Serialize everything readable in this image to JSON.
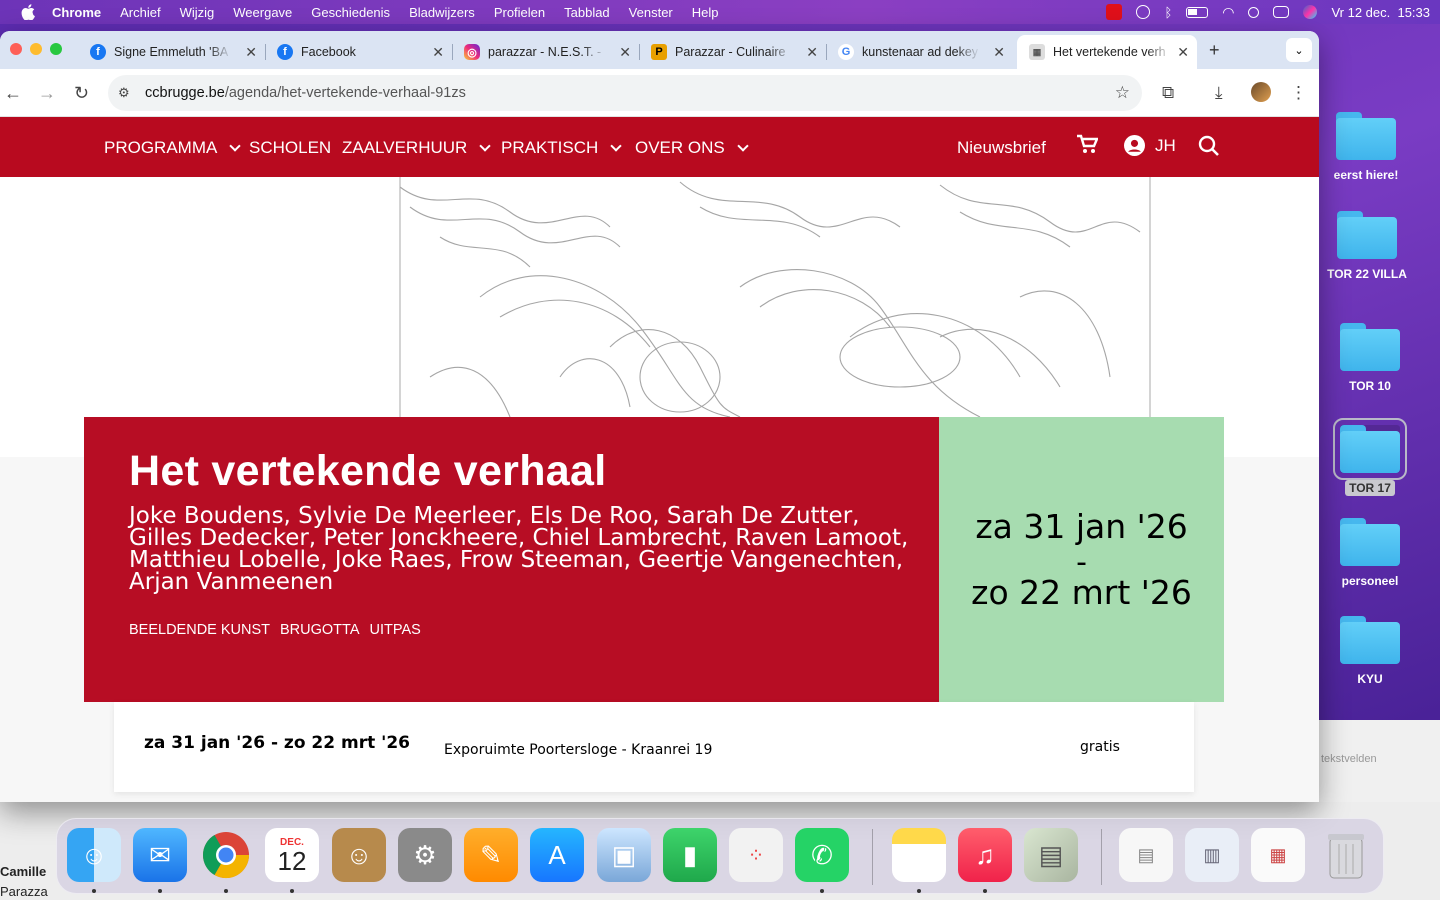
{
  "menubar": {
    "items": [
      "Chrome",
      "Archief",
      "Wijzig",
      "Weergave",
      "Geschiedenis",
      "Bladwijzers",
      "Profielen",
      "Tabblad",
      "Venster",
      "Help"
    ],
    "clock": "Vr 12 dec.  15:33"
  },
  "browser": {
    "tabs": [
      {
        "title": "Signe Emmeluth 'BA",
        "favicon": "facebook-icon",
        "color": "#1877f2"
      },
      {
        "title": "Facebook",
        "favicon": "facebook-icon",
        "color": "#1877f2"
      },
      {
        "title": "parazzar - N.E.S.T. -",
        "favicon": "instagram-icon",
        "color": "#d62976"
      },
      {
        "title": "Parazzar - Culinaire",
        "favicon": "parazzar-icon",
        "color": "#e8a000"
      },
      {
        "title": "kunstenaar ad dekey",
        "favicon": "google-icon",
        "color": "#4285f4"
      },
      {
        "title": "Het vertekende verh",
        "favicon": "site-icon",
        "color": "#666666"
      }
    ],
    "url_host": "ccbrugge.be",
    "url_path": "/agenda/het-vertekende-verhaal-91zs"
  },
  "site": {
    "brand_color": "#b80a1f",
    "nav": {
      "programma": "PROGRAMMA",
      "scholen": "SCHOLEN",
      "zaalverhuur": "ZAALVERHUUR",
      "praktisch": "PRAKTISCH",
      "over_ons": "OVER ONS",
      "newsletter": "Nieuwsbrief",
      "user_initials": "JH"
    },
    "event": {
      "title": "Het vertekende verhaal",
      "artists": "Joke Boudens, Sylvie De Meerleer, Els De Roo, Sarah De Zutter, Gilles Dedecker, Peter Jonckheere, Chiel Lambrecht, Raven Lamoot, Matthieu Lobelle, Joke Raes, Frow Steeman, Geertje Vangenechten, Arjan Vanmeenen",
      "tags": [
        "BEELDENDE KUNST",
        "BRUGOTTA",
        "UITPAS"
      ],
      "date_start": "za 31 jan '26",
      "date_dash": "-",
      "date_end": "zo 22 mrt '26",
      "info_when": "za 31 jan '26 - zo 22 mrt '26",
      "info_where": "Exporuimte Poortersloge - Kraanrei 19",
      "info_price": "gratis"
    }
  },
  "desktop": {
    "folders": [
      "eerst hiere!",
      "TOR 22 VILLA",
      "TOR 10",
      "TOR 17",
      "personeel",
      "KYU"
    ]
  },
  "background_text": {
    "tekstvelden": "tekstvelden",
    "camille": "Camille",
    "parazza": "Parazza"
  },
  "dock": {
    "calendar_month": "DEC.",
    "calendar_day": "12",
    "apps": [
      "finder",
      "mail",
      "chrome",
      "calendar",
      "contacts",
      "system-settings",
      "pages",
      "app-store",
      "preview",
      "numbers",
      "launchpad",
      "whatsapp",
      "notes",
      "music",
      "id-card",
      "doc-1",
      "doc-2",
      "doc-3",
      "trash"
    ]
  }
}
